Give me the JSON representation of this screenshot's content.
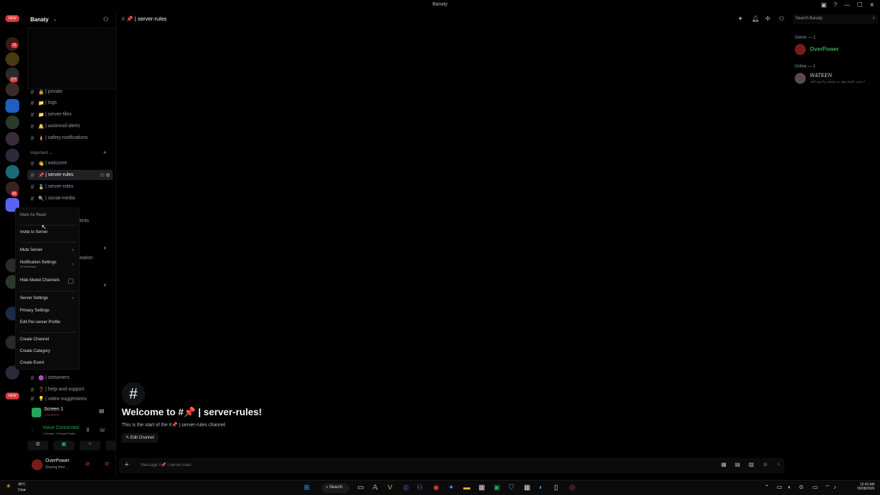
{
  "window": {
    "title": "Banaty"
  },
  "rail": {
    "badges": [
      "NEW",
      "21",
      "177",
      "81",
      "NEW"
    ]
  },
  "sidebar": {
    "server_name": "Banaty",
    "channels_top": [
      {
        "emoji": "🔒",
        "label": "| private"
      },
      {
        "emoji": "📁",
        "label": "| logs"
      },
      {
        "emoji": "📁",
        "label": "| server-files"
      },
      {
        "emoji": "🔔",
        "label": "| automod-alerts"
      },
      {
        "emoji": "🧯",
        "label": "| safety-notifications"
      }
    ],
    "category_important": "Important",
    "channels_important": [
      {
        "emoji": "👋",
        "label": "| welcome"
      },
      {
        "emoji": "📌",
        "label": "| server-rules"
      },
      {
        "emoji": "🏅",
        "label": "| server-roles"
      },
      {
        "emoji": "🔍",
        "label": "| social-media"
      }
    ],
    "hidden_partial_1": "ents",
    "hidden_partial_2": "eation",
    "channels_bottom": [
      {
        "emoji": "🟣",
        "label": "| streamers"
      },
      {
        "emoji": "❓",
        "label": "| help-and-support"
      },
      {
        "emoji": "💡",
        "label": "| video-suggestions"
      }
    ]
  },
  "context_menu": {
    "mark_as_read": "Mark As Read",
    "invite": "Invite to Server",
    "mute": "Mute Server",
    "notification_settings": "Notification Settings",
    "notification_sub": "All Messages",
    "hide_muted": "Hide Muted Channels",
    "server_settings": "Server Settings",
    "privacy_settings": "Privacy Settings",
    "edit_profile": "Edit Per-server Profile",
    "create_channel": "Create Channel",
    "create_category": "Create Category",
    "create_event": "Create Event"
  },
  "stream": {
    "title": "Screen 1",
    "quality": "720p 60FPS"
  },
  "voice": {
    "status": "Voice Connected",
    "detail": "1 Private / 1 Pursuit Studio ..."
  },
  "user": {
    "name": "OverPower",
    "status": "Sharing their ..."
  },
  "main": {
    "channel_name": "| server-rules",
    "search_placeholder": "Search Banaty",
    "welcome_title": "Welcome to #📌 | server-rules!",
    "welcome_sub": "This is the start of the #📌 | server-rules channel.",
    "edit_channel": "Edit Channel",
    "composer_placeholder": "Message #📌 | server-rules"
  },
  "members": {
    "owner_header": "Owner — 1",
    "owner_name": "OverPower",
    "online_header": "Online — 1",
    "online_name": "WATEEN",
    "online_status": "لا تحسب الحياة سهلة بعد معاشاتي ولا تفقد الأمل"
  },
  "taskbar": {
    "temp": "38°C",
    "weather": "Clear",
    "search": "Search",
    "time": "12:43 AM",
    "date": "05/08/2026"
  }
}
